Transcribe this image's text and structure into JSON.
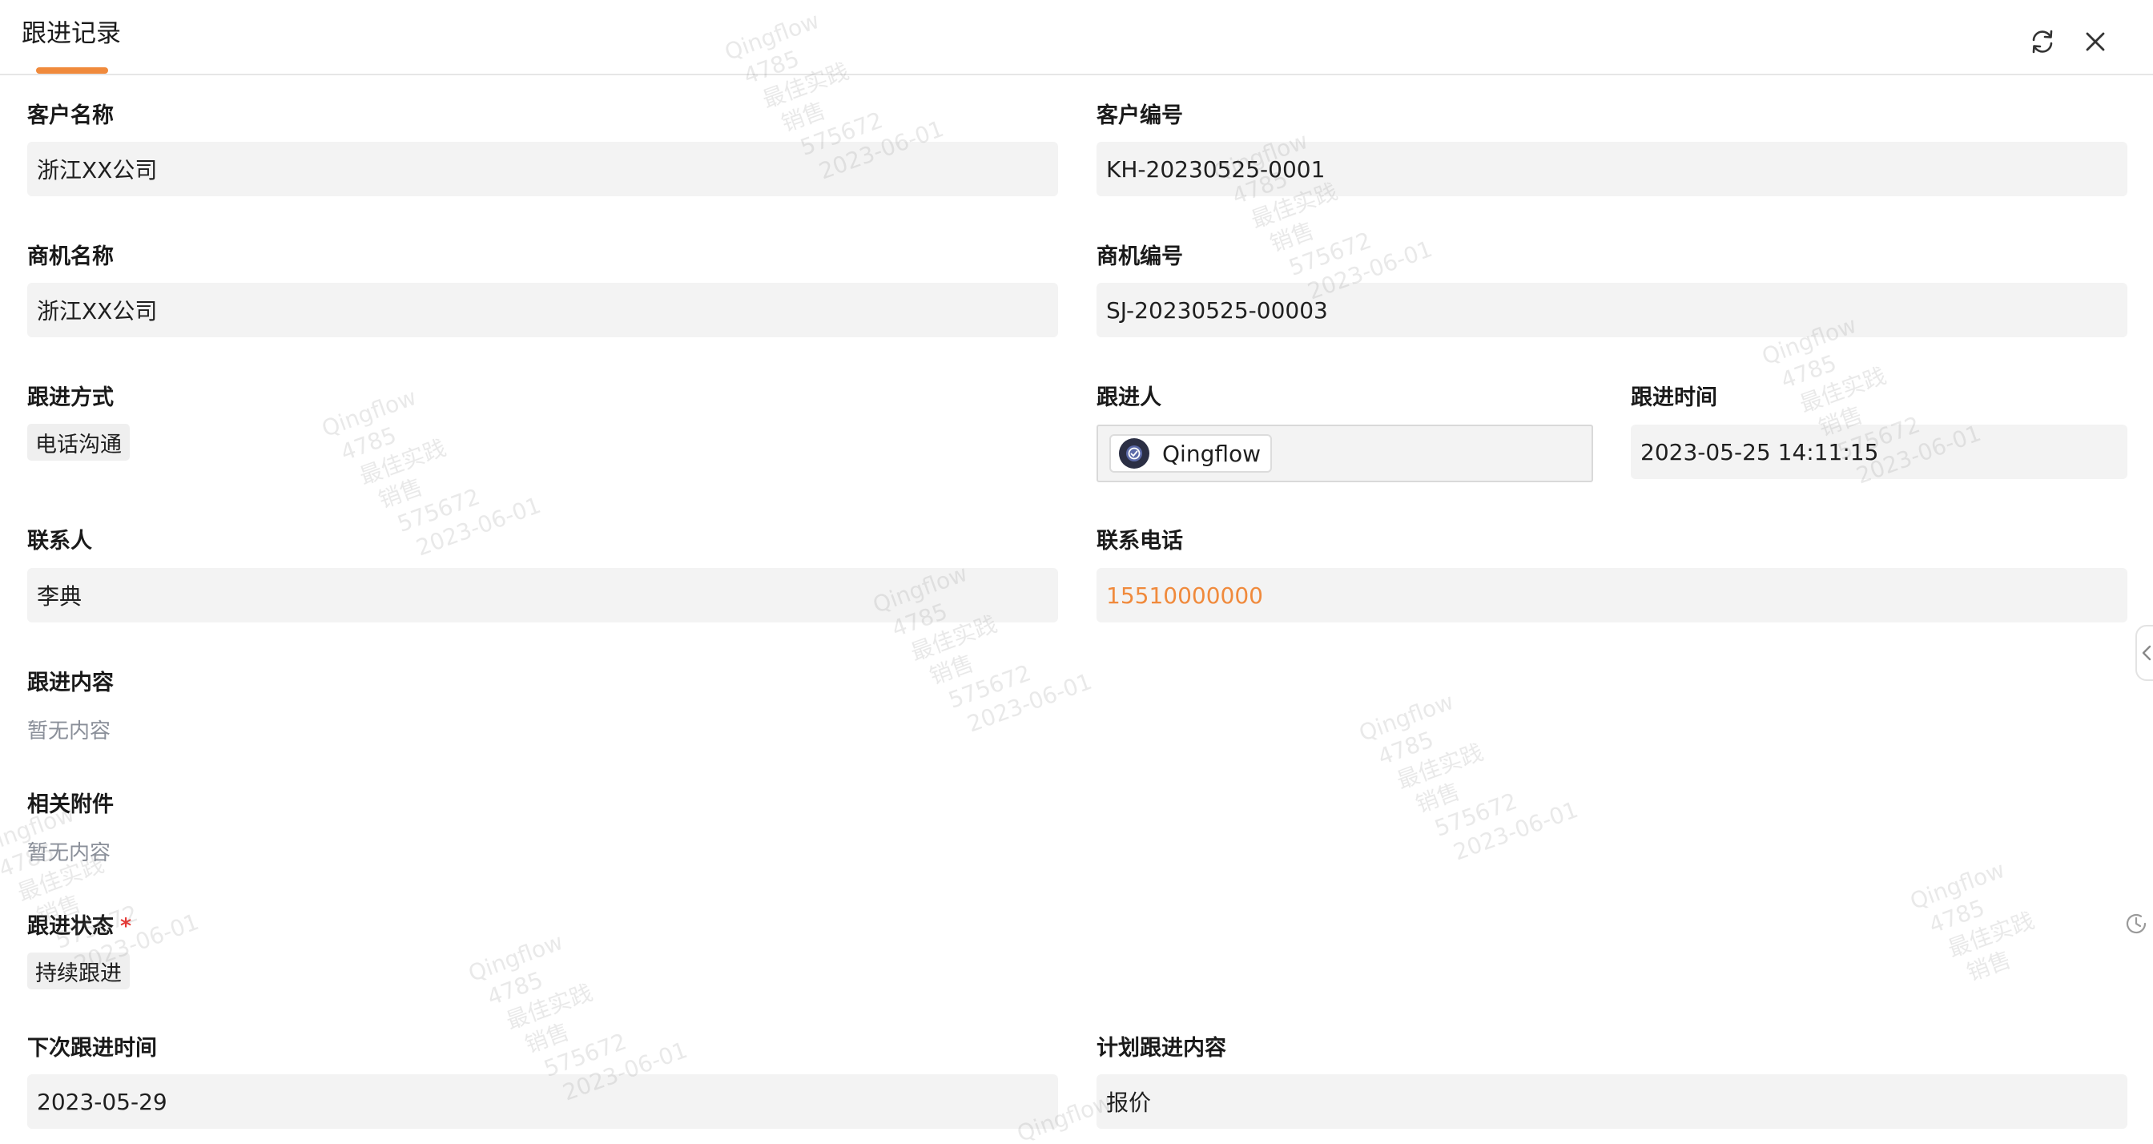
{
  "header": {
    "tab_title": "跟进记录"
  },
  "colors": {
    "accent": "#f08a3c",
    "required": "#e53935",
    "field_bg": "#f3f3f3"
  },
  "icons": {
    "refresh": "refresh-icon",
    "close": "close-icon",
    "history": "history-icon",
    "collapse": "chevron-left-icon"
  },
  "fields": {
    "customer_name": {
      "label": "客户名称",
      "value": "浙江XX公司"
    },
    "customer_no": {
      "label": "客户编号",
      "value": "KH-20230525-0001"
    },
    "opportunity_name": {
      "label": "商机名称",
      "value": "浙江XX公司"
    },
    "opportunity_no": {
      "label": "商机编号",
      "value": "SJ-20230525-00003"
    },
    "follow_method": {
      "label": "跟进方式",
      "value": "电话沟通"
    },
    "follower": {
      "label": "跟进人",
      "value": "Qingflow"
    },
    "follow_time": {
      "label": "跟进时间",
      "value": "2023-05-25 14:11:15"
    },
    "contact": {
      "label": "联系人",
      "value": "李典"
    },
    "contact_phone": {
      "label": "联系电话",
      "value": "15510000000"
    },
    "follow_content": {
      "label": "跟进内容",
      "value": "暂无内容"
    },
    "attachments": {
      "label": "相关附件",
      "value": "暂无内容"
    },
    "follow_status": {
      "label": "跟进状态",
      "required_mark": "*",
      "value": "持续跟进"
    },
    "next_follow_time": {
      "label": "下次跟进时间",
      "value": "2023-05-29"
    },
    "plan_content": {
      "label": "计划跟进内容",
      "value": "报价"
    }
  },
  "watermark": {
    "lines": [
      "Qingflow",
      "4785",
      "最佳实践",
      "销售",
      "575672",
      "2023-06-01"
    ]
  }
}
